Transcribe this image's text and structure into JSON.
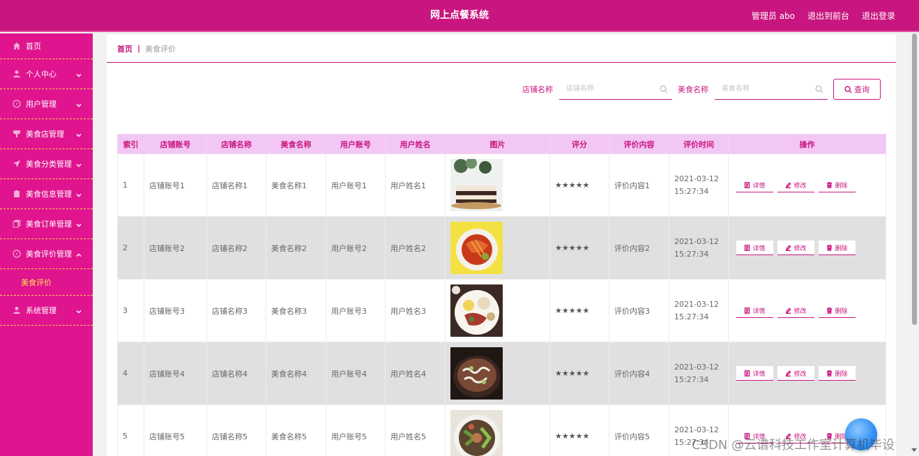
{
  "header": {
    "title": "网上点餐系统",
    "admin_label": "管理员 abo",
    "back_front": "退出到前台",
    "logout": "退出登录"
  },
  "sidebar": {
    "items": [
      {
        "label": "首页",
        "icon": "home-icon"
      },
      {
        "label": "个人中心",
        "icon": "user-icon"
      },
      {
        "label": "用户管理",
        "icon": "compass-icon"
      },
      {
        "label": "美食店管理",
        "icon": "cup-icon"
      },
      {
        "label": "美食分类管理",
        "icon": "send-icon"
      },
      {
        "label": "美食信息管理",
        "icon": "clipboard-icon"
      },
      {
        "label": "美食订单管理",
        "icon": "copy-icon"
      },
      {
        "label": "美食评价管理",
        "icon": "compass-icon"
      },
      {
        "label": "系统管理",
        "icon": "user-icon"
      }
    ],
    "active_sub": "美食评价"
  },
  "breadcrumb": {
    "home": "首页",
    "separator": "|",
    "current": "美食评价"
  },
  "search": {
    "shop_label": "店铺名称",
    "shop_placeholder": "店铺名称",
    "food_label": "美食名称",
    "food_placeholder": "美食名称",
    "query_label": "查询"
  },
  "table": {
    "columns": [
      "索引",
      "店铺账号",
      "店铺名称",
      "美食名称",
      "用户账号",
      "用户姓名",
      "图片",
      "评分",
      "评价内容",
      "评价时间",
      "操作"
    ],
    "rows": [
      {
        "index": "1",
        "shop_account": "店铺账号1",
        "shop_name": "店铺名称1",
        "food_name": "美食名称1",
        "user_account": "用户账号1",
        "user_name": "用户姓名1",
        "rating": "★★★★★",
        "content": "评价内容1",
        "time": "2021-03-12 15:27:34"
      },
      {
        "index": "2",
        "shop_account": "店铺账号2",
        "shop_name": "店铺名称2",
        "food_name": "美食名称2",
        "user_account": "用户账号2",
        "user_name": "用户姓名2",
        "rating": "★★★★★",
        "content": "评价内容2",
        "time": "2021-03-12 15:27:34"
      },
      {
        "index": "3",
        "shop_account": "店铺账号3",
        "shop_name": "店铺名称3",
        "food_name": "美食名称3",
        "user_account": "用户账号3",
        "user_name": "用户姓名3",
        "rating": "★★★★★",
        "content": "评价内容3",
        "time": "2021-03-12 15:27:34"
      },
      {
        "index": "4",
        "shop_account": "店铺账号4",
        "shop_name": "店铺名称4",
        "food_name": "美食名称4",
        "user_account": "用户账号4",
        "user_name": "用户姓名4",
        "rating": "★★★★★",
        "content": "评价内容4",
        "time": "2021-03-12 15:27:34"
      },
      {
        "index": "5",
        "shop_account": "店铺账号5",
        "shop_name": "店铺名称5",
        "food_name": "美食名称5",
        "user_account": "用户账号5",
        "user_name": "用户姓名5",
        "rating": "★★★★★",
        "content": "评价内容5",
        "time": "2021-03-12 15:27:34"
      }
    ],
    "actions": {
      "detail": "详情",
      "edit": "修改",
      "delete": "删除"
    }
  },
  "watermark": "CSDN @云谱科技工作室计算机毕设",
  "colors": {
    "primary": "#c8157f",
    "sidebar": "#e0148f",
    "header_bg": "#c8157f",
    "table_header": "#f3c7f3",
    "active_sub": "#ffe14d",
    "menu_divider": "#f2d04a"
  }
}
